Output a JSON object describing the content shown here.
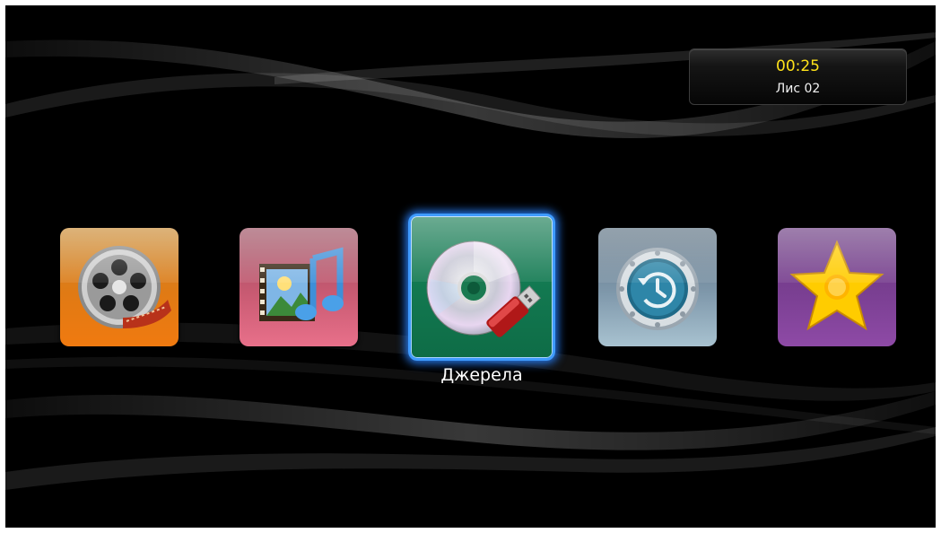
{
  "status": {
    "clock": "00:25",
    "page": "Лис 02"
  },
  "menu": {
    "items": [
      {
        "id": "video",
        "icon": "film-reel-icon"
      },
      {
        "id": "media",
        "icon": "photo-music-icon"
      },
      {
        "id": "sources",
        "icon": "disc-usb-icon",
        "label": "Джерела",
        "selected": true
      },
      {
        "id": "history",
        "icon": "clock-history-icon"
      },
      {
        "id": "favorites",
        "icon": "star-icon"
      }
    ],
    "selected_label": "Джерела"
  },
  "colors": {
    "clock": "#ffe21a",
    "selection_border": "#3f9bff",
    "background": "#000000"
  }
}
